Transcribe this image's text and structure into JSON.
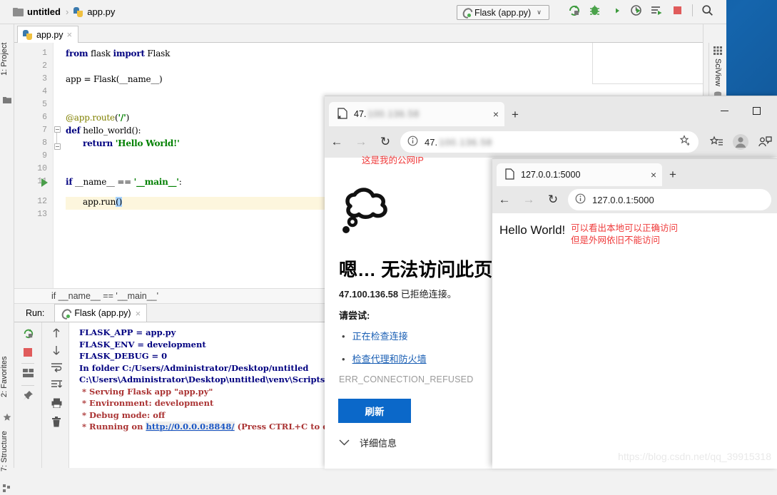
{
  "ide": {
    "breadcrumb": {
      "project": "untitled",
      "separator": "›",
      "file": "app.py"
    },
    "run_config": {
      "label": "Flask (app.py)",
      "chevron": "∨"
    },
    "toolbar_icons": [
      "rerun-icon",
      "debug-icon",
      "run-coverage-icon",
      "profile-icon",
      "run-with-console-icon",
      "stop-icon",
      "search-everywhere-icon"
    ],
    "left_tabs": [
      {
        "label": "1: Project",
        "icon": "project-folder-icon"
      },
      {
        "label": "2: Favorites",
        "icon": "star-icon"
      },
      {
        "label": "7: Structure",
        "icon": "structure-icon"
      }
    ],
    "right_tabs": [
      {
        "label": "SciView",
        "icon": "grid-icon"
      }
    ],
    "editor_tab": {
      "label": "app.py",
      "close": "×"
    },
    "line_numbers": [
      "1",
      "2",
      "3",
      "4",
      "5",
      "6",
      "7",
      "8",
      "9",
      "10",
      "11",
      "12",
      "13"
    ],
    "code_lines": [
      {
        "n": 1,
        "text": "from flask import Flask"
      },
      {
        "n": 2,
        "text": ""
      },
      {
        "n": 3,
        "text": "app = Flask(__name__)"
      },
      {
        "n": 4,
        "text": ""
      },
      {
        "n": 5,
        "text": ""
      },
      {
        "n": 6,
        "text": "@app.route('/')"
      },
      {
        "n": 7,
        "text": "def hello_world():"
      },
      {
        "n": 8,
        "text": "    return 'Hello World!'"
      },
      {
        "n": 9,
        "text": ""
      },
      {
        "n": 10,
        "text": ""
      },
      {
        "n": 11,
        "text": "if __name__ == '__main__':"
      },
      {
        "n": 12,
        "text": "    app.run()"
      },
      {
        "n": 13,
        "text": ""
      }
    ],
    "editor_status_breadcrumb": "if __name__ == '__main__'",
    "run_panel": {
      "label": "Run:",
      "tab_label": "Flask (app.py)",
      "tab_close": "×",
      "console_lines": [
        {
          "text": "FLASK_APP = app.py",
          "style": "blue"
        },
        {
          "text": "FLASK_ENV = development",
          "style": "blue"
        },
        {
          "text": "FLASK_DEBUG = 0",
          "style": "blue"
        },
        {
          "text": "In folder C:/Users/Administrator/Desktop/untitled",
          "style": "blue"
        },
        {
          "text": "C:\\Users\\Administrator\\Desktop\\untitled\\venv\\Scripts\\python.",
          "style": "blue"
        },
        {
          "text": " * Serving Flask app \"app.py\"",
          "style": "red"
        },
        {
          "text": " * Environment: development",
          "style": "red"
        },
        {
          "text": " * Debug mode: off",
          "style": "red"
        },
        {
          "text": " * Running on ",
          "link": "http://0.0.0.0:8848/",
          "tail": " (Press CTRL+C to quit)",
          "style": "red"
        }
      ],
      "side_icons": [
        "rerun-icon",
        "stop-icon",
        "layout-icon",
        "pin-icon",
        "scroll-up-icon",
        "scroll-down-icon",
        "soft-wrap-icon",
        "scroll-to-end-icon",
        "print-icon",
        "clear-all-icon"
      ]
    }
  },
  "browser1": {
    "tab_title_prefix": "47.",
    "tab_title_blurred": "100.136.58",
    "tab_close": "×",
    "new_tab": "+",
    "window_buttons": [
      "minimize",
      "maximize"
    ],
    "nav": {
      "back": "←",
      "forward": "→",
      "reload": "↻",
      "info": "ⓘ",
      "favorite": "☆",
      "collections": "collections-icon",
      "profile": "profile-icon",
      "share": "share-icon"
    },
    "address_prefix": "47.",
    "address_blurred": "100.136.58",
    "annotation": "这是我的公网IP",
    "error_page": {
      "heading": "嗯… 无法访问此页面",
      "subtitle_ip": "47.100.136.58",
      "subtitle_rest": " 已拒绝连接。",
      "try_label": "请尝试:",
      "suggestions": [
        "正在检查连接",
        "检查代理和防火墙"
      ],
      "error_code": "ERR_CONNECTION_REFUSED",
      "refresh_button": "刷新",
      "details_label": "详细信息"
    }
  },
  "browser2": {
    "tab_title": "127.0.0.1:5000",
    "tab_close": "×",
    "new_tab": "+",
    "nav": {
      "back": "←",
      "forward": "→",
      "reload": "↻",
      "info": "ⓘ"
    },
    "address": "127.0.0.1:5000",
    "page_text": "Hello World!",
    "annotation": "可以看出本地可以正确访问\n但是外网依旧不能访问"
  },
  "watermark": "https://blog.csdn.net/qq_39915318",
  "colors": {
    "accent_blue": "#0b68c9",
    "annotation_red": "#ef3b3b",
    "ide_bg": "#f2f2f2",
    "keyword": "#000080",
    "console_red": "#a33333",
    "run_green": "#4a9e4a",
    "stop_red": "#e05b5b"
  }
}
